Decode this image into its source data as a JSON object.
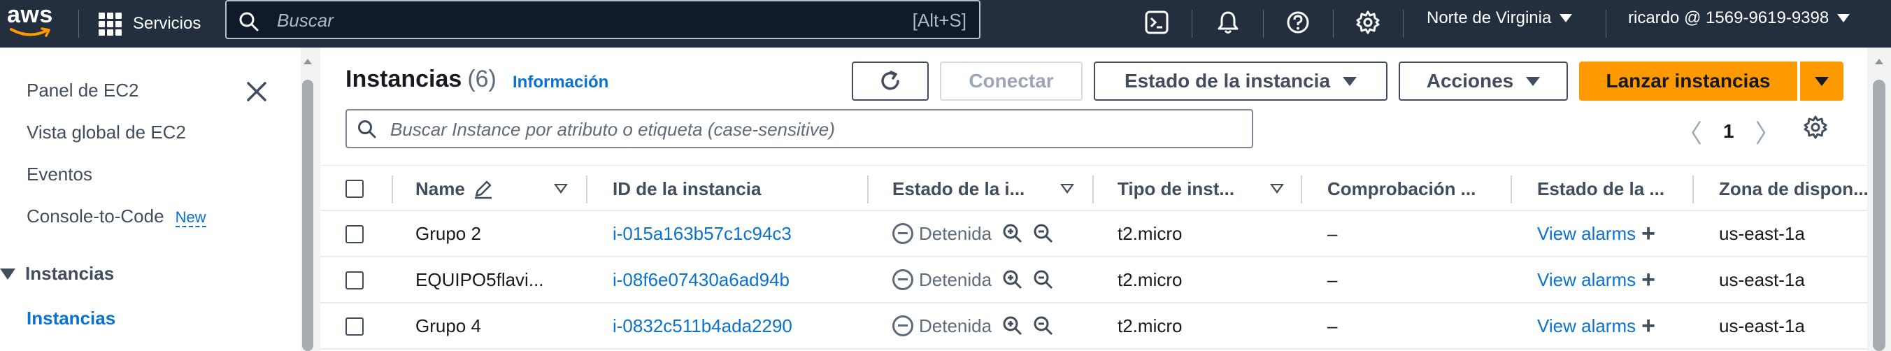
{
  "topnav": {
    "logo": "aws",
    "services_label": "Servicios",
    "search_placeholder": "Buscar",
    "search_shortcut": "[Alt+S]",
    "icons": [
      "cloudshell-icon",
      "bell-icon",
      "help-icon",
      "gear-icon"
    ],
    "region": "Norte de Virginia",
    "account": "ricardo @ 1569-9619-9398"
  },
  "sidebar": {
    "items": [
      {
        "label": "Panel de EC2"
      },
      {
        "label": "Vista global de EC2"
      },
      {
        "label": "Eventos"
      },
      {
        "label": "Console-to-Code",
        "badge": "New"
      }
    ],
    "section": "Instancias",
    "active_item": "Instancias"
  },
  "main": {
    "title": "Instancias",
    "count": "(6)",
    "info_link": "Información",
    "buttons": {
      "connect": "Conectar",
      "instance_state": "Estado de la instancia",
      "actions": "Acciones",
      "launch": "Lanzar instancias"
    },
    "filter_placeholder": "Buscar Instance por atributo o etiqueta (case-sensitive)",
    "pagination": {
      "current_page": "1"
    },
    "table": {
      "columns": [
        "Name",
        "ID de la instancia",
        "Estado de la i...",
        "Tipo de inst...",
        "Comprobación ...",
        "Estado de la ...",
        "Zona de dispon..."
      ],
      "rows": [
        {
          "name": "Grupo 2",
          "id": "i-015a163b57c1c94c3",
          "state": "Detenida",
          "type": "t2.micro",
          "check": "–",
          "alarm": "View alarms",
          "zone": "us-east-1a"
        },
        {
          "name": "EQUIPO5flavi...",
          "id": "i-08f6e07430a6ad94b",
          "state": "Detenida",
          "type": "t2.micro",
          "check": "–",
          "alarm": "View alarms",
          "zone": "us-east-1a"
        },
        {
          "name": "Grupo 4",
          "id": "i-0832c511b4ada2290",
          "state": "Detenida",
          "type": "t2.micro",
          "check": "–",
          "alarm": "View alarms",
          "zone": "us-east-1a"
        }
      ]
    }
  },
  "colors": {
    "nav_bg": "#232f3e",
    "accent": "#ff9900",
    "link": "#0972d3"
  }
}
